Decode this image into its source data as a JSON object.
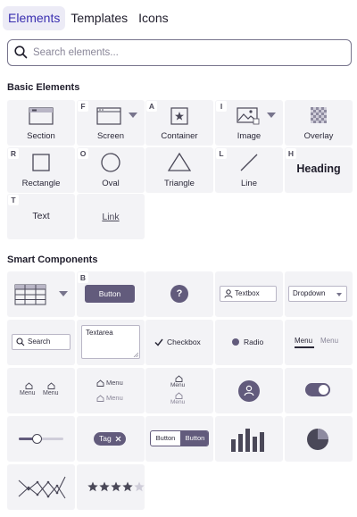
{
  "tabs": [
    {
      "label": "Elements"
    },
    {
      "label": "Templates"
    },
    {
      "label": "Icons"
    }
  ],
  "search": {
    "placeholder": "Search elements..."
  },
  "basic": {
    "title": "Basic Elements",
    "items": {
      "section": {
        "label": "Section"
      },
      "screen": {
        "label": "Screen",
        "key": "F"
      },
      "container": {
        "label": "Container",
        "key": "A"
      },
      "image": {
        "label": "Image",
        "key": "I"
      },
      "overlay": {
        "label": "Overlay"
      },
      "rectangle": {
        "label": "Rectangle",
        "key": "R"
      },
      "oval": {
        "label": "Oval",
        "key": "O"
      },
      "triangle": {
        "label": "Triangle"
      },
      "line": {
        "label": "Line",
        "key": "L"
      },
      "heading": {
        "label": "Heading",
        "key": "H"
      },
      "text": {
        "label": "Text",
        "key": "T"
      },
      "link": {
        "label": "Link"
      }
    }
  },
  "smart": {
    "title": "Smart Components",
    "button": {
      "label": "Button",
      "key": "B"
    },
    "help": {
      "label": "?"
    },
    "textbox": {
      "label": "Textbox"
    },
    "dropdown": {
      "label": "Dropdown"
    },
    "search": {
      "label": "Search"
    },
    "textarea": {
      "label": "Textarea"
    },
    "checkbox": {
      "label": "Checkbox"
    },
    "radio": {
      "label": "Radio"
    },
    "menu_tabs": {
      "active": "Menu",
      "inactive": "Menu"
    },
    "nav_icons": {
      "a": "Menu",
      "b": "Menu"
    },
    "menu_list": {
      "a": "Menu",
      "b": "Menu"
    },
    "nav_stack": {
      "a": "Menu",
      "b": "Menu"
    },
    "tag": {
      "label": "Tag"
    },
    "button_group": {
      "a": "Button",
      "b": "Button"
    },
    "slider": {
      "value": 0.4
    },
    "rating": {
      "value": 4,
      "max": 5
    }
  },
  "colors": {
    "accent": "#625b7c",
    "tile_bg": "#f3f3f6",
    "active_tab_bg": "#ecebf6",
    "active_tab_text": "#3a2fb0"
  }
}
